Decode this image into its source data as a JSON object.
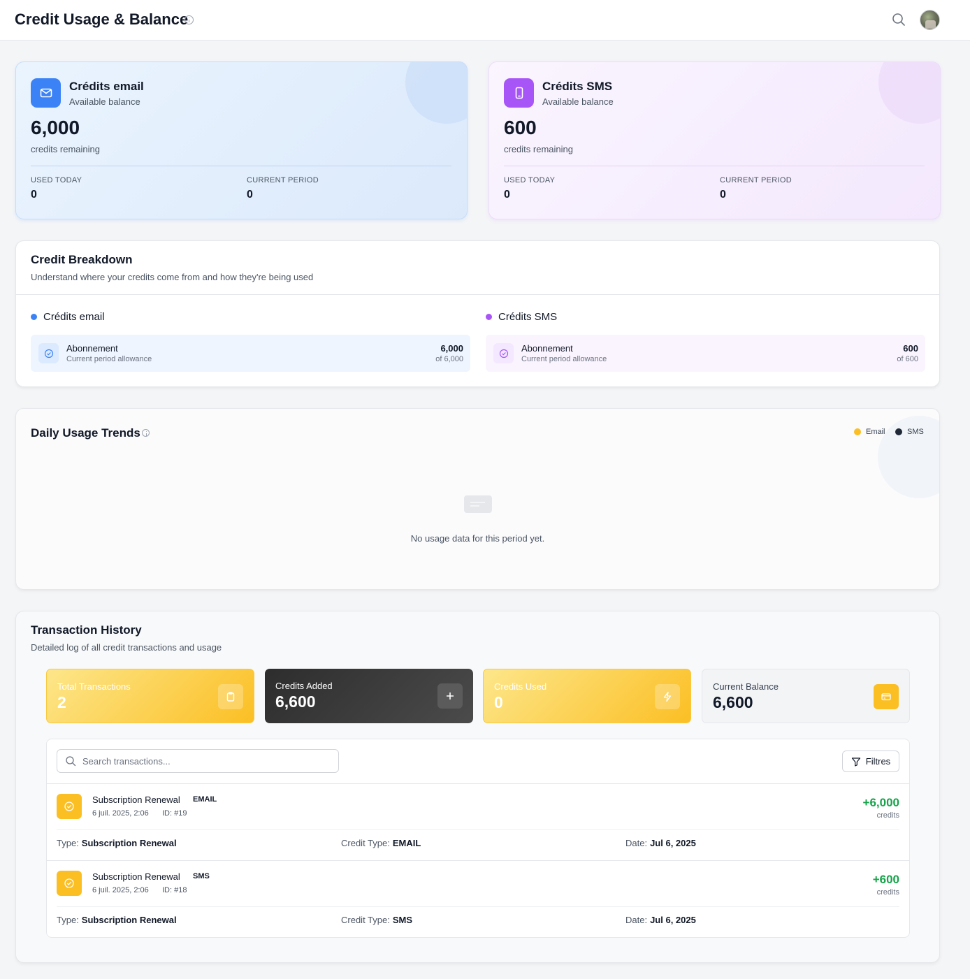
{
  "header": {
    "title": "Credit Usage & Balance",
    "info_icon": "info-icon",
    "search_icon": "search-icon",
    "avatar": "user-avatar"
  },
  "colors": {
    "email_accent": "#3b82f6",
    "sms_accent": "#a855f7",
    "yellow": "#fbbf24",
    "positive": "#16a34a",
    "dark": "#2d2d2d"
  },
  "balances": {
    "email": {
      "title": "Crédits email",
      "subtitle": "Available balance",
      "amount": "6,000",
      "remaining_label": "credits remaining",
      "used_today_label": "USED TODAY",
      "used_today": "0",
      "current_period_label": "CURRENT PERIOD",
      "current_period": "0",
      "icon": "mail-icon"
    },
    "sms": {
      "title": "Crédits SMS",
      "subtitle": "Available balance",
      "amount": "600",
      "remaining_label": "credits remaining",
      "used_today_label": "USED TODAY",
      "used_today": "0",
      "current_period_label": "CURRENT PERIOD",
      "current_period": "0",
      "icon": "phone-icon"
    }
  },
  "breakdown": {
    "title": "Credit Breakdown",
    "subtitle": "Understand where your credits come from and how they're being used",
    "email": {
      "heading": "Crédits email",
      "name": "Abonnement",
      "desc": "Current period allowance",
      "value": "6,000",
      "of": "of 6,000"
    },
    "sms": {
      "heading": "Crédits SMS",
      "name": "Abonnement",
      "desc": "Current period allowance",
      "value": "600",
      "of": "of 600"
    }
  },
  "trends": {
    "title": "Daily Usage Trends",
    "legend": [
      {
        "label": "Email",
        "color": "#fbbf24"
      },
      {
        "label": "SMS",
        "color": "#1f2937"
      }
    ],
    "empty_text": "No usage data for this period yet."
  },
  "history": {
    "title": "Transaction History",
    "subtitle": "Detailed log of all credit transactions and usage",
    "summary": [
      {
        "label": "Total Transactions",
        "value": "2",
        "icon": "clipboard-icon"
      },
      {
        "label": "Credits Added",
        "value": "6,600",
        "icon": "plus-icon"
      },
      {
        "label": "Credits Used",
        "value": "0",
        "icon": "lightning-icon"
      },
      {
        "label": "Current Balance",
        "value": "6,600",
        "icon": "credit-card-icon"
      }
    ],
    "search_placeholder": "Search transactions...",
    "filter_label": "Filtres",
    "transactions": [
      {
        "title": "Subscription Renewal",
        "badge": "EMAIL",
        "date_time": "6 juil. 2025, 2:06",
        "id": "ID: #19",
        "amount": "+6,000",
        "unit": "credits",
        "type_label": "Type:",
        "type": "Subscription Renewal",
        "credit_type_label": "Credit Type:",
        "credit_type": "EMAIL",
        "date_label": "Date:",
        "date": "Jul 6, 2025"
      },
      {
        "title": "Subscription Renewal",
        "badge": "SMS",
        "date_time": "6 juil. 2025, 2:06",
        "id": "ID: #18",
        "amount": "+600",
        "unit": "credits",
        "type_label": "Type:",
        "type": "Subscription Renewal",
        "credit_type_label": "Credit Type:",
        "credit_type": "SMS",
        "date_label": "Date:",
        "date": "Jul 6, 2025"
      }
    ]
  }
}
